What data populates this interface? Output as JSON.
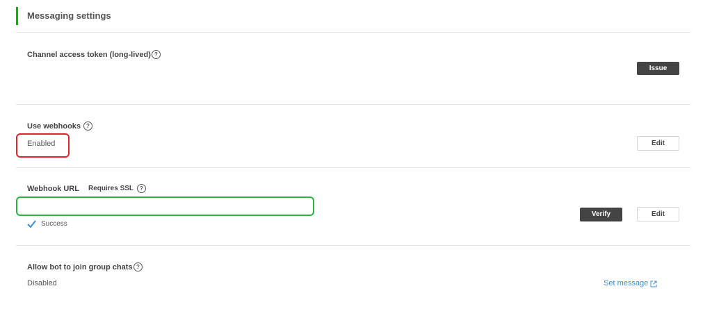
{
  "header": {
    "title": "Messaging settings",
    "accent_color": "#00b900"
  },
  "channel_token": {
    "label": "Channel access token (long-lived)",
    "help_icon": "?",
    "issue_label": "Issue"
  },
  "webhooks": {
    "label": "Use webhooks",
    "help_icon": "?",
    "status": "Enabled",
    "edit_label": "Edit"
  },
  "webhook_url": {
    "label": "Webhook URL",
    "ssl_label": "Requires SSL",
    "help_icon": "?",
    "value": "",
    "success_label": "Success",
    "verify_label": "Verify",
    "edit_label": "Edit"
  },
  "group_chats": {
    "label": "Allow bot to join group chats",
    "help_icon": "?",
    "status": "Disabled",
    "link_label": "Set message"
  },
  "colors": {
    "highlight_red": "#e0242f",
    "highlight_green": "#2db13f",
    "link_blue": "#3e8ed0"
  }
}
